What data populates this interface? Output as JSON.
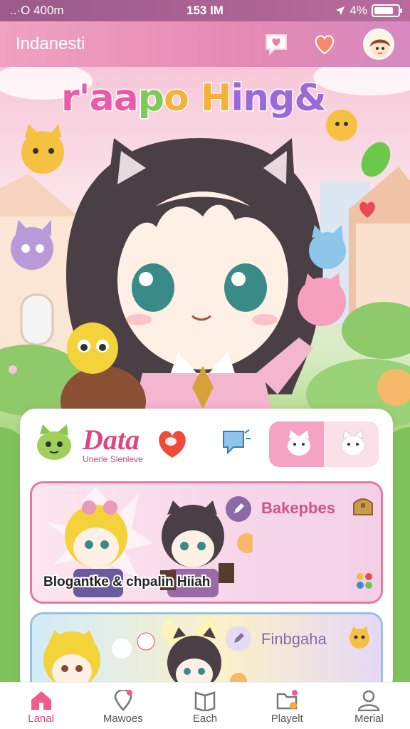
{
  "status_bar": {
    "left": "..·O 400m",
    "time": "153 IM",
    "battery_label": "4%",
    "battery_level": 0.8
  },
  "header": {
    "title": "Indanesti",
    "icons": [
      "chat-heart-icon",
      "heart-icon",
      "avatar"
    ]
  },
  "hero": {
    "logo_parts": [
      "r'aa",
      "p",
      "o H",
      "ing&"
    ]
  },
  "panel": {
    "brand": "Data",
    "brand_sub": "Unerle Slenleve",
    "cards": [
      {
        "title": "Bakepbes",
        "caption": "Blogantke & chpalin Hiiah"
      },
      {
        "title": "Finbgaha"
      }
    ]
  },
  "bottom_nav": [
    {
      "label": "Lanal",
      "icon": "home-icon",
      "active": true
    },
    {
      "label": "Mawoes",
      "icon": "map-pin-icon",
      "active": false
    },
    {
      "label": "Each",
      "icon": "book-icon",
      "active": false
    },
    {
      "label": "Playelt",
      "icon": "folder-icon",
      "active": false
    },
    {
      "label": "Merial",
      "icon": "user-icon",
      "active": false
    }
  ],
  "colors": {
    "accent": "#e0457f",
    "header": "#e58ab2",
    "status": "#9a5a8a"
  }
}
